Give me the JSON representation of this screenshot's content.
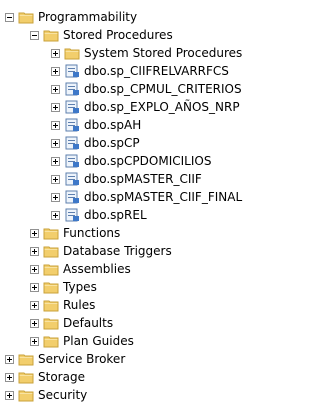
{
  "tree": {
    "items": [
      {
        "label": "Programmability",
        "expanded": true,
        "icon": "folder-icon"
      },
      {
        "label": "Stored Procedures",
        "expanded": true,
        "icon": "folder-icon"
      },
      {
        "label": "System Stored Procedures",
        "expanded": false,
        "icon": "folder-icon"
      },
      {
        "label": "dbo.sp_CIIFRELVARRFCS",
        "expanded": false,
        "icon": "stored-procedure-icon"
      },
      {
        "label": "dbo.sp_CPMUL_CRITERIOS",
        "expanded": false,
        "icon": "stored-procedure-icon"
      },
      {
        "label": "dbo.sp_EXPLO_AÑOS_NRP",
        "expanded": false,
        "icon": "stored-procedure-icon"
      },
      {
        "label": "dbo.spAH",
        "expanded": false,
        "icon": "stored-procedure-icon"
      },
      {
        "label": "dbo.spCP",
        "expanded": false,
        "icon": "stored-procedure-icon"
      },
      {
        "label": "dbo.spCPDOMICILIOS",
        "expanded": false,
        "icon": "stored-procedure-icon"
      },
      {
        "label": "dbo.spMASTER_CIIF",
        "expanded": false,
        "icon": "stored-procedure-icon"
      },
      {
        "label": "dbo.spMASTER_CIIF_FINAL",
        "expanded": false,
        "icon": "stored-procedure-icon"
      },
      {
        "label": "dbo.spREL",
        "expanded": false,
        "icon": "stored-procedure-icon"
      },
      {
        "label": "Functions",
        "expanded": false,
        "icon": "folder-icon"
      },
      {
        "label": "Database Triggers",
        "expanded": false,
        "icon": "folder-icon"
      },
      {
        "label": "Assemblies",
        "expanded": false,
        "icon": "folder-icon"
      },
      {
        "label": "Types",
        "expanded": false,
        "icon": "folder-icon"
      },
      {
        "label": "Rules",
        "expanded": false,
        "icon": "folder-icon"
      },
      {
        "label": "Defaults",
        "expanded": false,
        "icon": "folder-icon"
      },
      {
        "label": "Plan Guides",
        "expanded": false,
        "icon": "folder-icon"
      },
      {
        "label": "Service Broker",
        "expanded": false,
        "icon": "folder-icon"
      },
      {
        "label": "Storage",
        "expanded": false,
        "icon": "folder-icon"
      },
      {
        "label": "Security",
        "expanded": false,
        "icon": "folder-icon"
      }
    ]
  },
  "colors": {
    "folder": "#F2CE6C",
    "folder_edge": "#C9A23A",
    "proc_sheet": "#EEF4FB",
    "proc_edge": "#5E7FAE",
    "proc_accent": "#3E78C8"
  }
}
